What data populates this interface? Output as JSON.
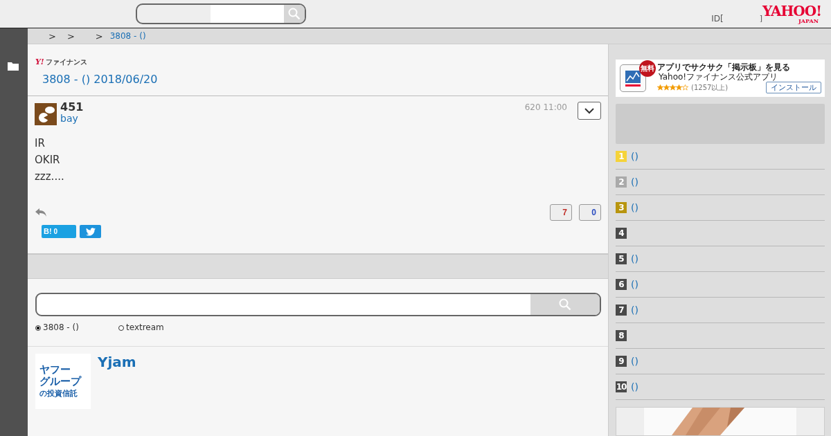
{
  "header": {
    "login_text": "ID[",
    "login_suffix": "]",
    "logo": "YAHOO!",
    "logo_sub": "JAPAN"
  },
  "breadcrumb": {
    "separators": [
      ">",
      ">",
      ">"
    ],
    "current": "3808 - ()"
  },
  "board": {
    "brand": "ファイナンス",
    "brand_mark": "Y!",
    "title": "3808 - () 2018/06/20"
  },
  "post": {
    "number": "451",
    "user": "bay",
    "time": "620 11:00",
    "lines": [
      "IR",
      "OKIR",
      "zzz...."
    ],
    "likes": "7",
    "dislikes": "0",
    "hatena_label": "B!",
    "hatena_count": "0"
  },
  "search": {
    "options": [
      {
        "label": "3808 - ()",
        "selected": true
      },
      {
        "label": "textream",
        "selected": false
      }
    ]
  },
  "promo": {
    "badge_lines": [
      "ヤフー",
      "グループ",
      "の投資信託"
    ],
    "title": "Yjam"
  },
  "ad": {
    "badge": "無料",
    "title": "アプリでサクサク「掲示板」を見る",
    "subtitle": "Yahoo!ファイナンス公式アプリ",
    "stars": 4,
    "reviews": "(1257以上)",
    "button": "インストール"
  },
  "ranking": [
    {
      "rank": "1",
      "color": "#f5d33a",
      "title": "()"
    },
    {
      "rank": "2",
      "color": "#aaaaaa",
      "title": "()"
    },
    {
      "rank": "3",
      "color": "#b8950f",
      "title": "()"
    },
    {
      "rank": "4",
      "color": "#4a4a4a"
    },
    {
      "rank": "5",
      "color": "#4a4a4a",
      "title": "()"
    },
    {
      "rank": "6",
      "color": "#4a4a4a",
      "title": "()"
    },
    {
      "rank": "7",
      "color": "#4a4a4a",
      "title": "()"
    },
    {
      "rank": "8",
      "color": "#4a4a4a"
    },
    {
      "rank": "9",
      "color": "#4a4a4a",
      "title": "()"
    },
    {
      "rank": "10",
      "color": "#4a4a4a",
      "title": "()"
    }
  ]
}
